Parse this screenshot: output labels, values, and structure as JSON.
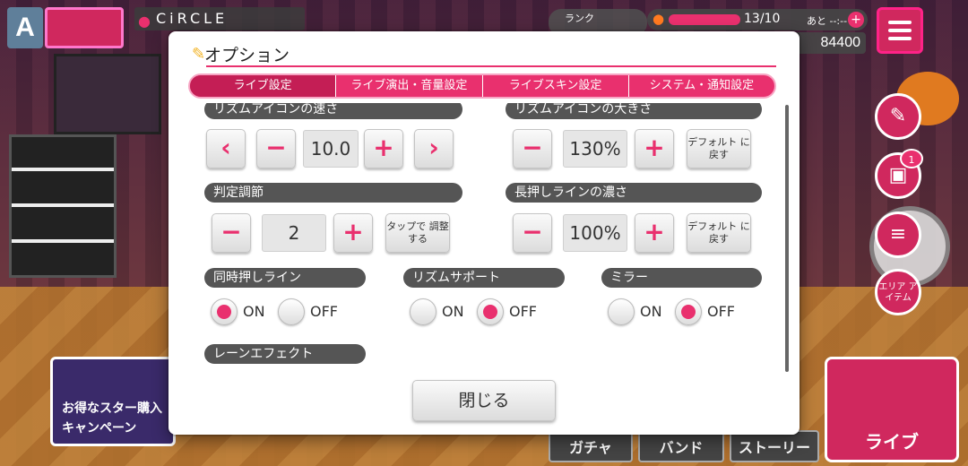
{
  "hud": {
    "top_left_letter": "A",
    "location": "CiRCLE",
    "rank_label": "ランク",
    "stamina_value": "13/10",
    "stamina_time_label": "あと --:--",
    "stamina_plus": "+",
    "coins": "84400",
    "area_item_label": "エリア アイテム",
    "gift_badge": "1"
  },
  "background": {
    "campaign_text": "お得なスター購入 キャンペーン",
    "bottom_buttons": [
      "ガチャ",
      "バンド",
      "ストーリー"
    ],
    "live_button": "ライブ"
  },
  "modal": {
    "title": "オプション",
    "tabs": [
      "ライブ設定",
      "ライブ演出・音量設定",
      "ライブスキン設定",
      "システム・通知設定"
    ],
    "note_speed": {
      "label": "リズムアイコンの速さ",
      "value": "10.0",
      "left_arrow": "‹",
      "minus": "−",
      "plus": "+",
      "right_arrow": "›"
    },
    "note_size": {
      "label": "リズムアイコンの大きさ",
      "value": "130%",
      "minus": "−",
      "plus": "+",
      "default_button": "デフォルト に戻す"
    },
    "judge_adjust": {
      "label": "判定調節",
      "value": "2",
      "minus": "−",
      "plus": "+",
      "tap_button": "タップで 調整する"
    },
    "long_line": {
      "label": "長押しラインの濃さ",
      "value": "100%",
      "minus": "−",
      "plus": "+",
      "default_button": "デフォルト に戻す"
    },
    "simul_line": {
      "label": "同時押しライン",
      "on_label": "ON",
      "off_label": "OFF",
      "selected": "ON"
    },
    "rhythm_support": {
      "label": "リズムサポート",
      "on_label": "ON",
      "off_label": "OFF",
      "selected": "OFF"
    },
    "mirror": {
      "label": "ミラー",
      "on_label": "ON",
      "off_label": "OFF",
      "selected": "OFF"
    },
    "lane_effect": {
      "label": "レーンエフェクト"
    },
    "close_button": "閉じる"
  }
}
